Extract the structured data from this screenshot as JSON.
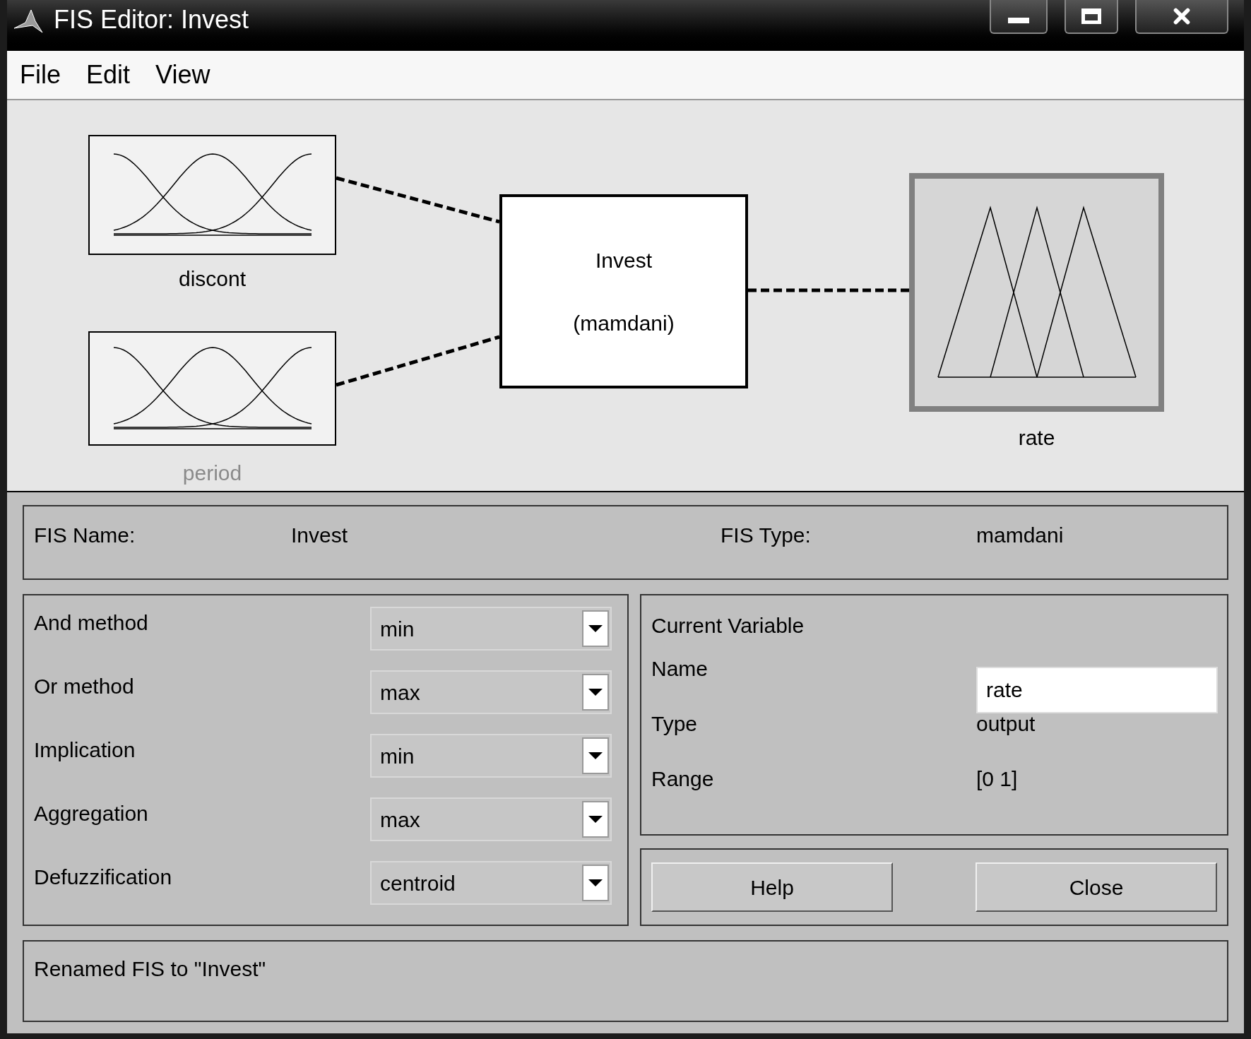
{
  "window": {
    "title": "FIS Editor: Invest"
  },
  "menu": [
    "File",
    "Edit",
    "View"
  ],
  "diagram": {
    "inputs": [
      {
        "name": "discont",
        "selected": false,
        "dimmed": false,
        "kind": "gaussian"
      },
      {
        "name": "period",
        "selected": false,
        "dimmed": true,
        "kind": "gaussian"
      }
    ],
    "system": {
      "name": "Invest",
      "type": "(mamdani)"
    },
    "outputs": [
      {
        "name": "rate",
        "selected": true,
        "dimmed": false,
        "kind": "triangular"
      }
    ]
  },
  "fis": {
    "name_label": "FIS Name:",
    "name": "Invest",
    "type_label": "FIS Type:",
    "type": "mamdani"
  },
  "methods": [
    {
      "label": "And method",
      "value": "min"
    },
    {
      "label": "Or method",
      "value": "max"
    },
    {
      "label": "Implication",
      "value": "min"
    },
    {
      "label": "Aggregation",
      "value": "max"
    },
    {
      "label": "Defuzzification",
      "value": "centroid"
    }
  ],
  "current_variable": {
    "title": "Current Variable",
    "fields": [
      {
        "label": "Name",
        "value": "rate",
        "kind": "input"
      },
      {
        "label": "Type",
        "value": "output",
        "kind": "text"
      },
      {
        "label": "Range",
        "value": "[0 1]",
        "kind": "text"
      }
    ]
  },
  "buttons": [
    "Help",
    "Close"
  ],
  "status": "Renamed FIS to \"Invest\""
}
